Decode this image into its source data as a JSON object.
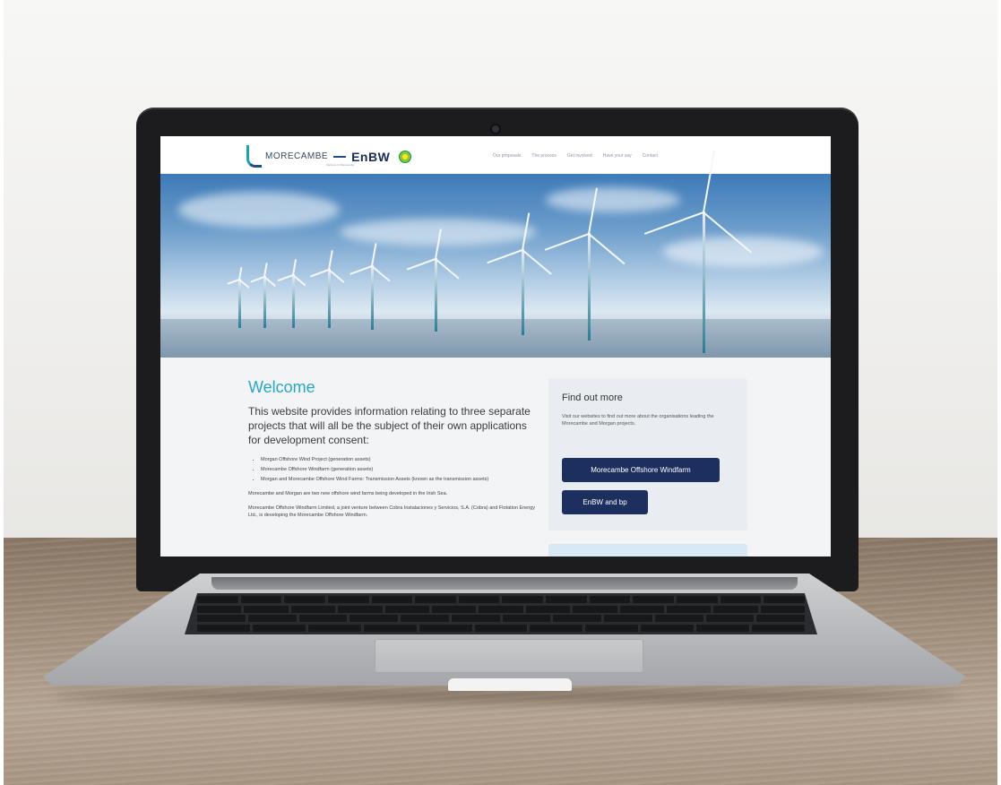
{
  "site": {
    "logo": {
      "morecambe": "MORECAMBE",
      "enbw": "EnBW",
      "tagline": "Partners in Morecambe"
    },
    "nav": [
      "Our proposals",
      "The process",
      "Get involved",
      "Have your say",
      "Contact"
    ]
  },
  "main": {
    "welcome_title": "Welcome",
    "intro": "This website provides information relating to three separate projects that will all be the subject of their own applications for development consent:",
    "projects": [
      "Morgan Offshore Wind Project (generation assets)",
      "Morecambe Offshore Windfarm (generation assets)",
      "Morgan and Morecambe Offshore Wind Farms: Transmission Assets (known as the transmission assets)"
    ],
    "paragraph_1": "Morecambe and Morgan are two new offshore wind farms being developed in the Irish Sea.",
    "paragraph_2": "Morecambe Offshore Windfarm Limited, a joint venture between Cobra Instalaciones y Servicios, S.A. (Cobra) and Flotation Energy Ltd., is developing the Morecambe Offshore Windfarm."
  },
  "sidebar": {
    "title": "Find out more",
    "text": "Visit our websites to find out more about the organisations leading the Morecambe and Morgan projects.",
    "button_1": "Morecambe Offshore Windfarm",
    "button_2": "EnBW and bp"
  },
  "colors": {
    "accent": "#2aa6c6",
    "button": "#1d2f5e",
    "laptop_bezel": "#1c1c1e"
  }
}
